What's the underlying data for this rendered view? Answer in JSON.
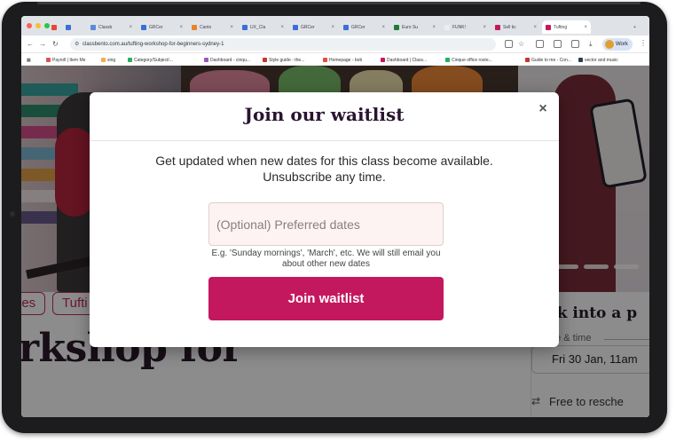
{
  "browser": {
    "tabs": [
      {
        "label": "Classb",
        "color": "#5b8bd6"
      },
      {
        "label": "GRCer",
        "color": "#3a6fd8"
      },
      {
        "label": "Canto",
        "color": "#e8842a"
      },
      {
        "label": "UX_Cla",
        "color": "#3a6fd8"
      },
      {
        "label": "GRCer",
        "color": "#3a6fd8"
      },
      {
        "label": "GRCer",
        "color": "#3a6fd8"
      },
      {
        "label": "Euro Su",
        "color": "#1f7a3a"
      },
      {
        "label": "FUNK!",
        "color": "#eeeeee"
      },
      {
        "label": "Sell tic",
        "color": "#c4185e"
      },
      {
        "label": "Tufting",
        "color": "#c4185e"
      }
    ],
    "active_tab": 9,
    "new_tab_label": "+",
    "url": "classbento.com.au/tufting-workshop-for-beginners-sydney-1",
    "profile_label": "Work",
    "bookmarks": [
      {
        "label": "Payroll | Item Me",
        "color": "#d9534f"
      },
      {
        "label": "sing",
        "color": "#f0ad4e"
      },
      {
        "label": "Category/Subject/...",
        "color": "#27ae60"
      },
      {
        "label": "Dashboard - cinqu...",
        "color": "#9b59b6"
      },
      {
        "label": "Style guide - the...",
        "color": "#c0392b"
      },
      {
        "label": "Homepage - bob",
        "color": "#e74c3c"
      },
      {
        "label": "Dashboard | Class...",
        "color": "#c4185e"
      },
      {
        "label": "Cinque office roste...",
        "color": "#27ae60"
      },
      {
        "label": "Guide to me - Con...",
        "color": "#c0392b"
      },
      {
        "label": "vector and music",
        "color": "#2c3e50"
      }
    ]
  },
  "page": {
    "pills": [
      "ies",
      "Tufti"
    ],
    "title": "orkshop for",
    "sidebar": {
      "title": "ook into a p",
      "date_label": "Date & time",
      "date_value": "Fri 30 Jan, 11am",
      "free_label": "Free to resche"
    }
  },
  "modal": {
    "title": "Join our waitlist",
    "close_glyph": "×",
    "description": "Get updated when new dates for this class become available. Unsubscribe any time.",
    "input_placeholder": "(Optional) Preferred dates",
    "input_value": "",
    "hint": "E.g. 'Sunday mornings', 'March', etc. We will still email you about other new dates",
    "button_label": "Join waitlist"
  },
  "colors": {
    "accent": "#c4185e",
    "title_text": "#2a1430",
    "input_bg": "#fdf3f2"
  }
}
